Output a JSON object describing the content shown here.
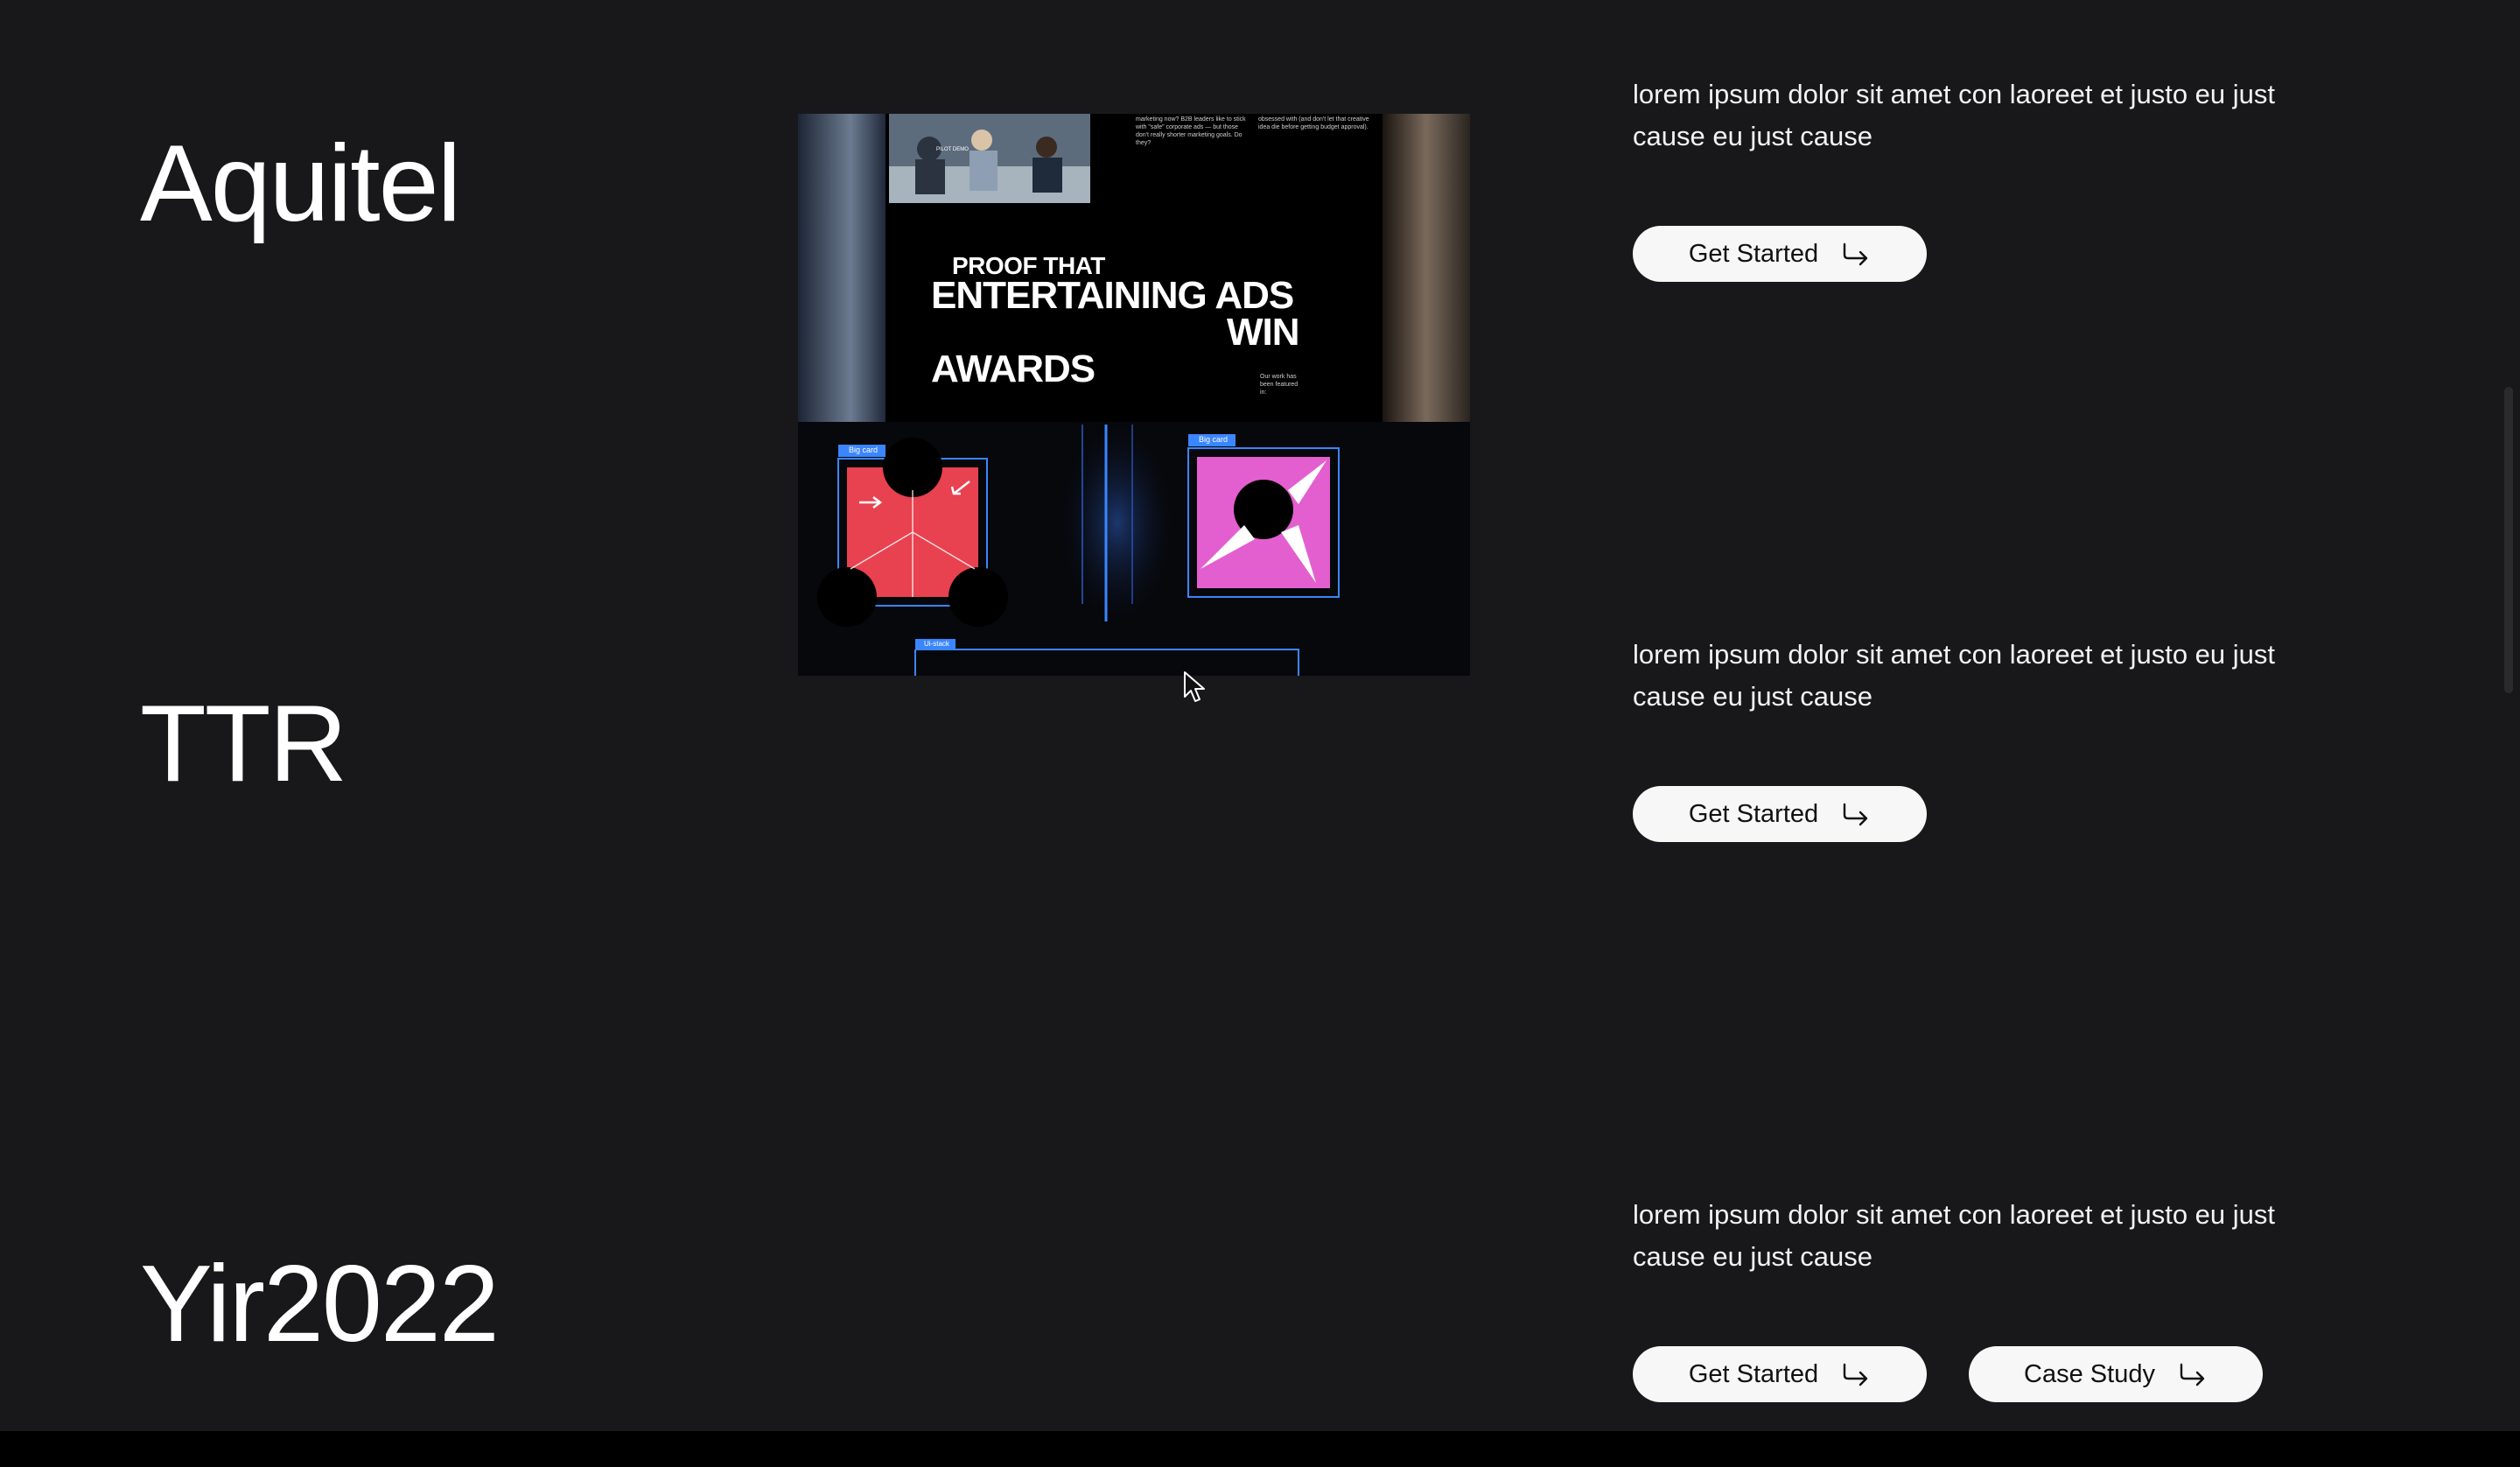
{
  "projects": [
    {
      "name": "Aquitel",
      "description": "lorem ipsum dolor sit amet con laoreet et justo eu just cause eu just cause",
      "buttons": [
        "Get Started"
      ]
    },
    {
      "name": "TTR",
      "description": "lorem ipsum dolor sit amet con laoreet et justo eu just cause eu just cause",
      "buttons": [
        "Get Started"
      ]
    },
    {
      "name": "Yir2022",
      "description": "lorem ipsum dolor sit amet con laoreet et justo eu just cause eu just cause",
      "buttons": [
        "Get Started",
        "Case Study"
      ]
    }
  ],
  "preview": {
    "headline_top": "PROOF THAT",
    "headline_main_1": "ENTERTAINING ADS",
    "headline_main_2": "WIN",
    "headline_main_3": "AWARDS",
    "side_note": "Our work has been featured in:",
    "copy_left": "marketing now? B2B leaders like to stick with \"safe\" corporate ads — but those don't really shorter marketing goals. Do they?",
    "copy_right": "obsessed with (and don't let that creative idea die before getting budget approval).",
    "frame_label_1": "Big card",
    "frame_label_2": "Big card",
    "frame_label_3": "Ui-stack",
    "photo_badge": "PILOT DEMO"
  },
  "colors": {
    "background": "#18181a",
    "text": "#ffffff",
    "button_bg": "#f7f7f7",
    "button_text": "#111111",
    "accent_red": "#e8414f",
    "accent_pink": "#e35fcf",
    "selection_blue": "#3a86ff"
  },
  "icons": {
    "button_arrow": "arrow-return-right-icon",
    "cursor": "mouse-pointer-icon"
  }
}
